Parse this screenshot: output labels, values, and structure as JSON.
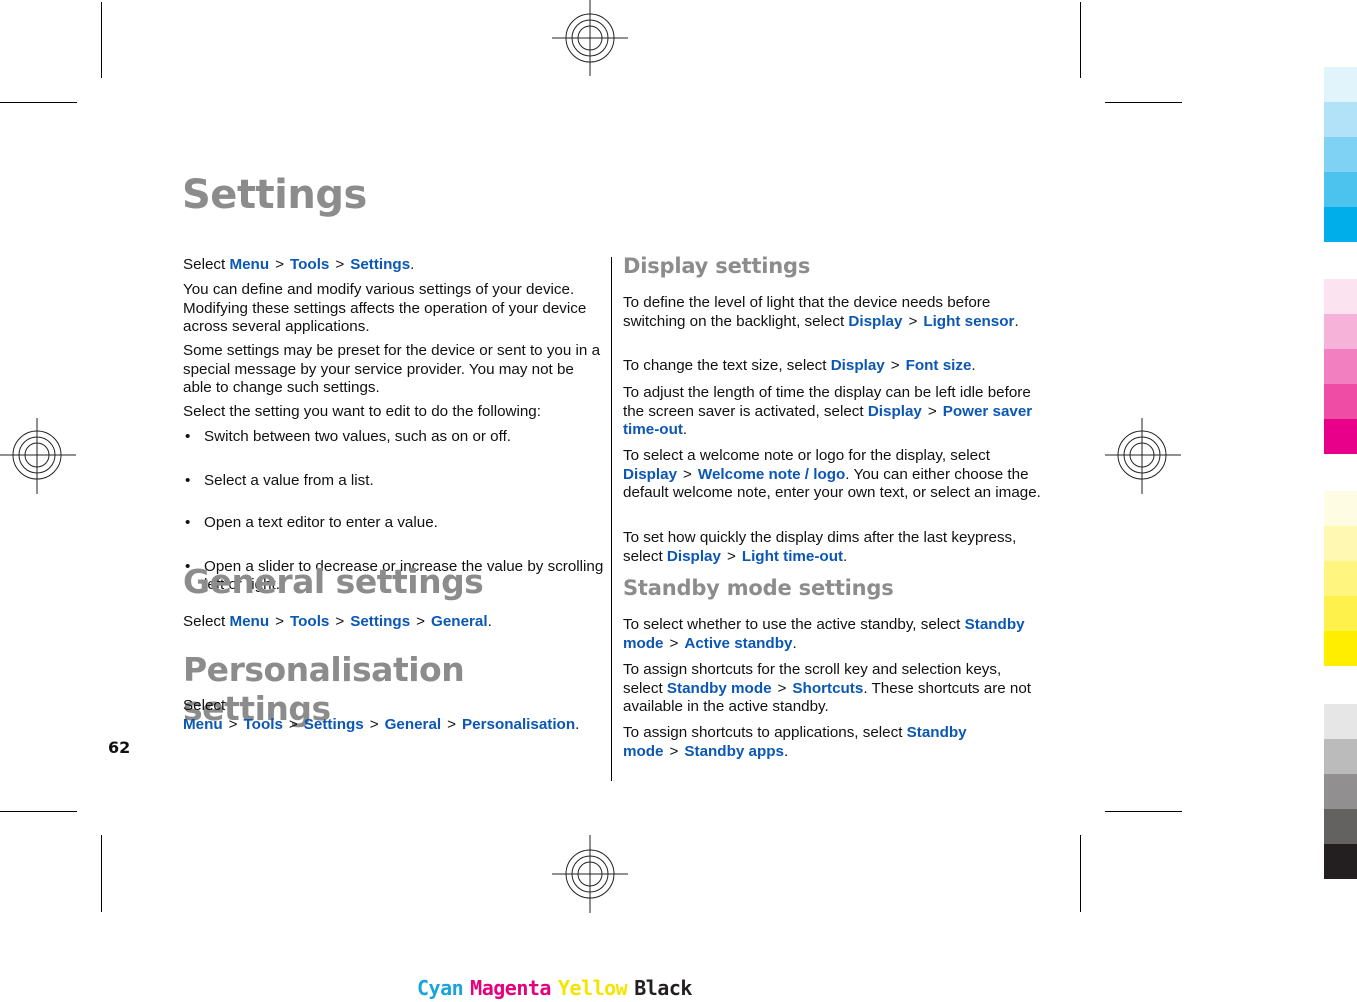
{
  "page": {
    "title": "Settings",
    "page_number": "62"
  },
  "left_column": {
    "intro_path": {
      "prefix": "Select",
      "items": [
        "Menu",
        "Tools",
        "Settings"
      ],
      "suffix": "."
    },
    "paragraphs": [
      "You can define and modify various settings of your device. Modifying these settings affects the operation of your device across several applications.",
      "Some settings may be preset for the device or sent to you in a special message by your service provider. You may not be able to change such settings.",
      "Select the setting you want to edit to do the following:"
    ],
    "bullets": [
      "Switch between two values, such as on or off.",
      "Select a value from a list.",
      "Open a text editor to enter a value.",
      "Open a slider to decrease or increase the value by scrolling left or right."
    ],
    "general": {
      "heading": "General settings",
      "prefix": "Select",
      "items": [
        "Menu",
        "Tools",
        "Settings",
        "General"
      ],
      "suffix": "."
    },
    "personalisation": {
      "heading": "Personalisation settings",
      "prefix": "Select",
      "items": [
        "Menu",
        "Tools",
        "Settings",
        "General",
        "Personalisation"
      ],
      "suffix": "."
    }
  },
  "right_column": {
    "display": {
      "heading": "Display settings",
      "entries": [
        {
          "text": "To define the level of light that the device needs before switching on the backlight, select",
          "items": [
            "Display",
            "Light sensor"
          ],
          "after": "."
        },
        {
          "text": "To change the text size, select",
          "items": [
            "Display",
            "Font size"
          ],
          "after": "."
        },
        {
          "text": "To adjust the length of time the display can be left idle before the screen saver is activated, select",
          "items": [
            "Display",
            "Power saver time-out"
          ],
          "after": "."
        },
        {
          "text": "To select a welcome note or logo for the display, select",
          "items": [
            "Display",
            "Welcome note / logo"
          ],
          "after": ". You can either choose the default welcome note, enter your own text, or select an image."
        },
        {
          "text": "To set how quickly the display dims after the last keypress, select",
          "items": [
            "Display",
            "Light time-out"
          ],
          "after": "."
        }
      ]
    },
    "standby": {
      "heading": "Standby mode settings",
      "entries": [
        {
          "text": "To select whether to use the active standby, select",
          "items": [
            "Standby mode",
            "Active standby"
          ],
          "after": "."
        },
        {
          "text": "To assign shortcuts for the scroll key and selection keys, select",
          "items": [
            "Standby mode",
            "Shortcuts"
          ],
          "after": ". These shortcuts are not available in the active standby."
        },
        {
          "text": "To assign shortcuts to applications, select",
          "items": [
            "Standby mode",
            "Standby apps"
          ],
          "after": "."
        }
      ]
    }
  },
  "separator_glyph": ">",
  "bullet_glyph": "•",
  "colors": {
    "link": "#0b57b4",
    "heading": "#8c8c8c",
    "cyan_swatches": [
      "#e1f3fb",
      "#b1e2f7",
      "#7fd2f3",
      "#4cc3ef",
      "#00aeea"
    ],
    "magenta_swatches": [
      "#fce3f0",
      "#f7b2d9",
      "#f27fc0",
      "#ee4ca5",
      "#e8008a"
    ],
    "yellow_swatches": [
      "#fffce4",
      "#fff8b2",
      "#fff57f",
      "#fff14c",
      "#ffee00"
    ],
    "black_swatches": [
      "#e6e6e6",
      "#bcbbbb",
      "#918f8f",
      "#646261",
      "#231f20"
    ]
  },
  "cmyk_labels": [
    {
      "label": "Cyan",
      "color": "#1ba3dc"
    },
    {
      "label": "Magenta",
      "color": "#e5007e"
    },
    {
      "label": "Yellow",
      "color": "#f5e400"
    },
    {
      "label": "Black",
      "color": "#231f20"
    }
  ]
}
